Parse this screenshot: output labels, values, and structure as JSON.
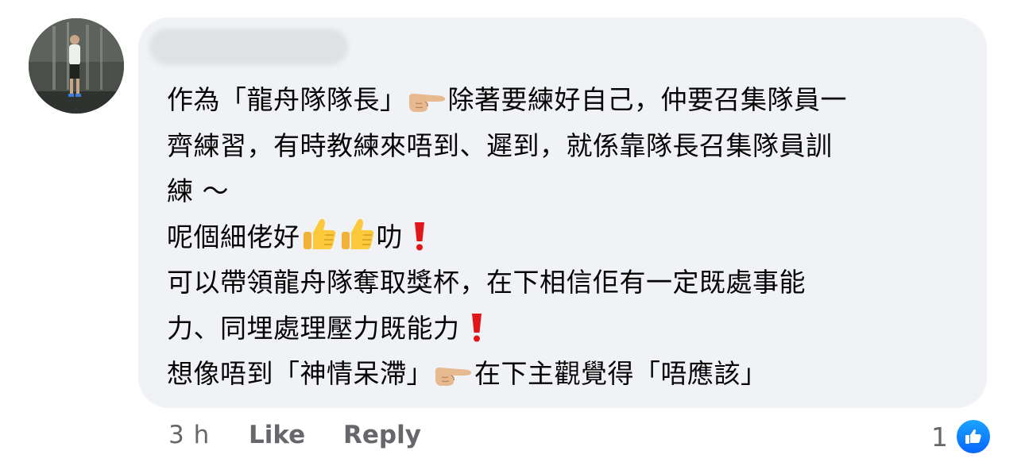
{
  "comment": {
    "lines": [
      [
        "作為「龍舟隊隊長」",
        "finger",
        "除著要練好自己，仲要召集隊員一"
      ],
      [
        "齊練習，有時教練來唔到、遲到，就係靠隊長召集隊員訓"
      ],
      [
        "練 ～"
      ],
      [
        "呢個細佬好",
        "thumbs",
        "thumbs",
        "叻 ",
        "exclaim"
      ],
      [
        "可以帶領龍舟隊奪取獎杯，在下相信佢有一定既處事能"
      ],
      [
        "力、同埋處理壓力既能力 ",
        "exclaim"
      ],
      [
        "想像唔到「神情呆滯」",
        "finger",
        "在下主觀覺得「唔應該」"
      ]
    ]
  },
  "meta": {
    "timestamp": "3 h",
    "like_label": "Like",
    "reply_label": "Reply",
    "reaction_count": "1"
  },
  "icons": {
    "finger": "backhand-index-pointing-right-emoji",
    "thumbs": "thumbs-up-emoji",
    "exclaim": "red-exclamation-mark-emoji",
    "reaction": "like-reaction-icon"
  },
  "colors": {
    "bubble": "#f0f2f5",
    "text": "#050505",
    "meta": "#65676b",
    "like_blue": "#0866ff"
  }
}
